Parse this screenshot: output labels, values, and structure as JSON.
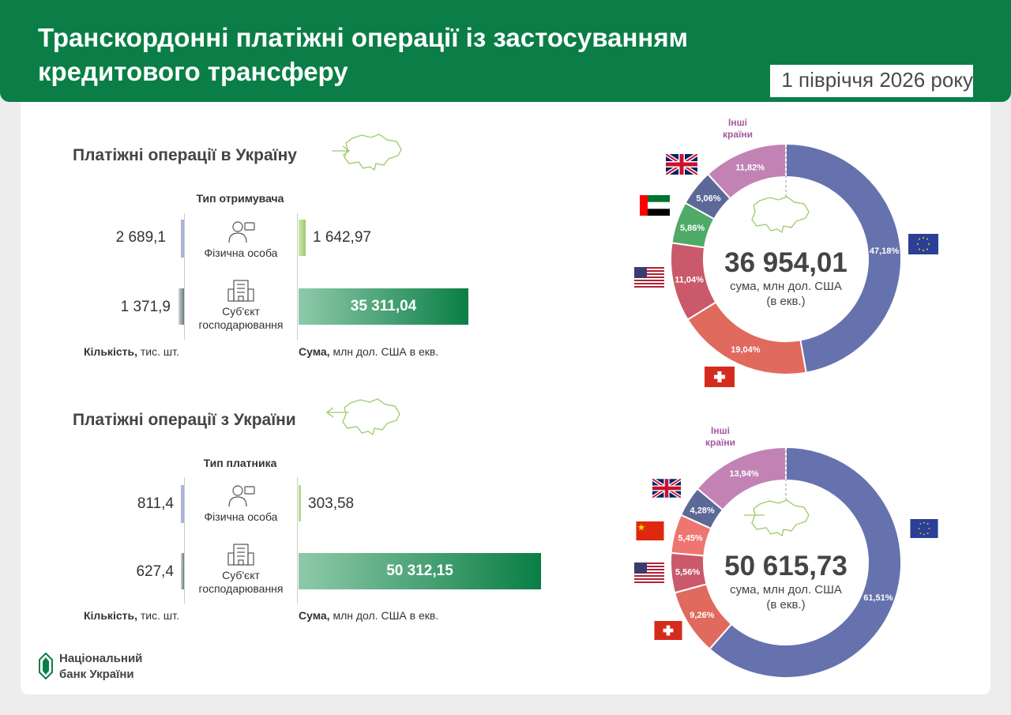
{
  "header": {
    "title_line1": "Транскордонні платіжні операції із застосуванням",
    "title_line2": "кредитового трансферу",
    "period": "1 півріччя 2026 року"
  },
  "colors": {
    "brand": "#0a7e46",
    "eu": "#6572ad",
    "ch": "#e06a5d",
    "us": "#c9596b",
    "ae": "#4faa68",
    "gb": "#5c6898",
    "cn": "#ee7670",
    "other": "#c282b4"
  },
  "inbound": {
    "title": "Платіжні операції в Україну",
    "type_label": "Тип отримувача",
    "rows": [
      {
        "count": "2 689,1",
        "type": "Фізична особа",
        "type2": "",
        "sum": "1 642,97"
      },
      {
        "count": "1 371,9",
        "type": "Суб'єкт",
        "type2": "господарювання",
        "sum": "35 311,04"
      }
    ],
    "count_label_bold": "Кількість,",
    "count_label": " тис. шт.",
    "sum_label_bold": "Сума,",
    "sum_label": " млн дол. США в екв."
  },
  "outbound": {
    "title": "Платіжні операції з України",
    "type_label": "Тип платника",
    "rows": [
      {
        "count": "811,4",
        "type": "Фізична особа",
        "type2": "",
        "sum": "303,58"
      },
      {
        "count": "627,4",
        "type": "Суб'єкт",
        "type2": "господарювання",
        "sum": "50 312,15"
      }
    ],
    "count_label_bold": "Кількість,",
    "count_label": " тис. шт.",
    "sum_label_bold": "Сума,",
    "sum_label": " млн дол. США в екв."
  },
  "donuts": {
    "inbound_total": "36 954,01",
    "outbound_total": "50 615,73",
    "sub1": "сума, млн дол. США",
    "sub2": "(в екв.)",
    "other_line1": "Інші",
    "other_line2": "країни"
  },
  "logo": {
    "line1": "Національний",
    "line2": "банк України"
  },
  "chart_data": [
    {
      "type": "bar",
      "title": "Платіжні операції в Україну",
      "categories": [
        "Фізична особа",
        "Суб'єкт господарювання"
      ],
      "series": [
        {
          "name": "Кількість, тис. шт.",
          "values": [
            2689.1,
            1371.9
          ]
        },
        {
          "name": "Сума, млн дол. США в екв.",
          "values": [
            1642.97,
            35311.04
          ]
        }
      ]
    },
    {
      "type": "bar",
      "title": "Платіжні операції з України",
      "categories": [
        "Фізична особа",
        "Суб'єкт господарювання"
      ],
      "series": [
        {
          "name": "Кількість, тис. шт.",
          "values": [
            811.4,
            627.4
          ]
        },
        {
          "name": "Сума, млн дол. США в екв.",
          "values": [
            303.58,
            50312.15
          ]
        }
      ]
    },
    {
      "type": "pie",
      "title": "36 954,01",
      "slices": [
        {
          "key": "eu",
          "value": 47.18,
          "label": "47,18%"
        },
        {
          "key": "ch",
          "value": 19.04,
          "label": "19,04%"
        },
        {
          "key": "us",
          "value": 11.04,
          "label": "11,04%"
        },
        {
          "key": "ae",
          "value": 5.86,
          "label": "5,86%"
        },
        {
          "key": "gb",
          "value": 5.06,
          "label": "5,06%"
        },
        {
          "key": "other",
          "value": 11.82,
          "label": "11,82%"
        }
      ]
    },
    {
      "type": "pie",
      "title": "50 615,73",
      "slices": [
        {
          "key": "eu",
          "value": 61.51,
          "label": "61,51%"
        },
        {
          "key": "ch",
          "value": 9.26,
          "label": "9,26%"
        },
        {
          "key": "us",
          "value": 5.56,
          "label": "5,56%"
        },
        {
          "key": "cn",
          "value": 5.45,
          "label": "5,45%"
        },
        {
          "key": "gb",
          "value": 4.28,
          "label": "4,28%"
        },
        {
          "key": "other",
          "value": 13.94,
          "label": "13,94%"
        }
      ]
    }
  ]
}
